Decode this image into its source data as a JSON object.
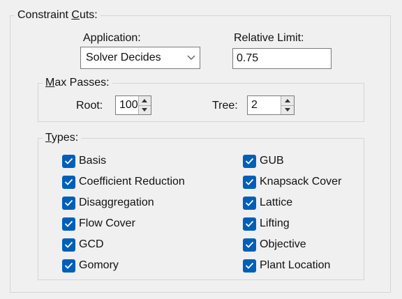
{
  "constraint_cuts": {
    "legend_pre": "Constraint ",
    "legend_ul": "C",
    "legend_post": "uts:",
    "application": {
      "label": "Application:",
      "value": "Solver Decides"
    },
    "relative_limit": {
      "label": "Relative Limit:",
      "value": "0.75"
    },
    "max_passes": {
      "legend_ul": "M",
      "legend_post": "ax Passes:",
      "root_label": "Root:",
      "root_value": "100",
      "tree_label": "Tree:",
      "tree_value": "2"
    },
    "types": {
      "legend_ul": "T",
      "legend_post": "ypes:",
      "left": [
        {
          "label": "Basis",
          "checked": true
        },
        {
          "label": "Coefficient Reduction",
          "checked": true
        },
        {
          "label": "Disaggregation",
          "checked": true
        },
        {
          "label": "Flow Cover",
          "checked": true
        },
        {
          "label": "GCD",
          "checked": true
        },
        {
          "label": "Gomory",
          "checked": true
        }
      ],
      "right": [
        {
          "label": "GUB",
          "checked": true
        },
        {
          "label": "Knapsack Cover",
          "checked": true
        },
        {
          "label": "Lattice",
          "checked": true
        },
        {
          "label": "Lifting",
          "checked": true
        },
        {
          "label": "Objective",
          "checked": true
        },
        {
          "label": "Plant Location",
          "checked": true
        }
      ]
    }
  },
  "colors": {
    "checkbox": "#005fb8",
    "background": "#f0f0f0",
    "border": "#d5d5d5"
  }
}
